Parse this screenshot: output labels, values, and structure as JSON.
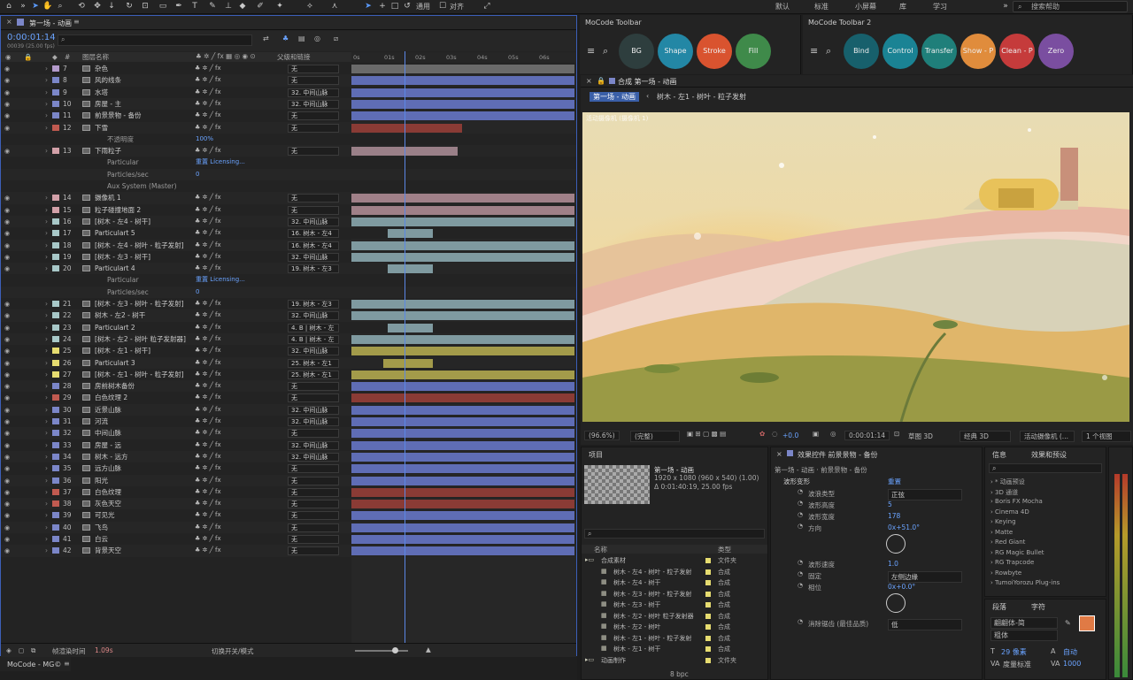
{
  "menu": {
    "workspaces": [
      "默认",
      "标准",
      "小屏幕",
      "库",
      "学习"
    ],
    "search_placeholder": "搜索帮助",
    "align_label": "对齐",
    "usage_label": "通用"
  },
  "timeline": {
    "tab_title": "第一场 - 动画",
    "timecode": "0:00:01:14",
    "fps_label": "00039 (25.00 fps)",
    "columns": {
      "name": "图层名称",
      "parent": "父级和链接",
      "hash": "#"
    },
    "ruler": [
      "0s",
      "01s",
      "02s",
      "03s",
      "04s",
      "05s",
      "06s"
    ],
    "footer_render": "帧渲染时间",
    "render_time": "1.09s",
    "switch_label": "切换开关/模式",
    "rows": [
      {
        "n": "7",
        "name": "杂色",
        "parent": "无",
        "label": "#b39acb",
        "bar": "#6a6a6a",
        "bs": 0,
        "be": 100
      },
      {
        "n": "8",
        "name": "风的线条",
        "parent": "无",
        "label": "#7b86c8",
        "bar": "#5f6db5",
        "bs": 0,
        "be": 100
      },
      {
        "n": "9",
        "name": "水塔",
        "parent": "32. 中间山脉",
        "label": "#7b86c8",
        "bar": "#5f6db5",
        "bs": 0,
        "be": 100
      },
      {
        "n": "10",
        "name": "房屋 - 主",
        "parent": "32. 中间山脉",
        "label": "#7b86c8",
        "bar": "#5f6db5",
        "bs": 0,
        "be": 100
      },
      {
        "n": "11",
        "name": "前景景物 - 备份",
        "parent": "无",
        "label": "#7b86c8",
        "bar": "#5f6db5",
        "bs": 0,
        "be": 100
      },
      {
        "n": "12",
        "name": "下雪",
        "parent": "无",
        "label": "#c05a50",
        "bar": "#8a3b35",
        "bs": 0,
        "be": 50
      },
      {
        "n": "",
        "name": "不透明度",
        "parent": "",
        "label": "",
        "bar": "",
        "bs": 0,
        "be": 0,
        "sub": true,
        "val": "100%"
      },
      {
        "n": "13",
        "name": "下雨粒子",
        "parent": "无",
        "label": "#d2a0a8",
        "bar": "#9a8088",
        "bs": 0,
        "be": 48
      },
      {
        "n": "",
        "name": "Particular",
        "parent": "",
        "label": "",
        "bar": "",
        "bs": 0,
        "be": 0,
        "sub": true,
        "val": "重置   Licensing..."
      },
      {
        "n": "",
        "name": "Particles/sec",
        "parent": "",
        "label": "",
        "bar": "",
        "bs": 0,
        "be": 0,
        "sub": true,
        "val": "0"
      },
      {
        "n": "",
        "name": "Aux System (Master)",
        "parent": "",
        "label": "",
        "bar": "",
        "bs": 0,
        "be": 0,
        "sub": true,
        "val": ""
      },
      {
        "n": "14",
        "name": "摄像机 1",
        "parent": "无",
        "label": "#d2a0a8",
        "bar": "#a08088",
        "bs": 0,
        "be": 100
      },
      {
        "n": "15",
        "name": "粒子碰撞地面 2",
        "parent": "无",
        "label": "#d2a0a8",
        "bar": "#a08088",
        "bs": 0,
        "be": 100
      },
      {
        "n": "16",
        "name": "[树木 - 左4 - 树干]",
        "parent": "32. 中间山脉",
        "label": "#a8c8c8",
        "bar": "#7f9aa0",
        "bs": 0,
        "be": 100
      },
      {
        "n": "17",
        "name": "Particulart 5",
        "parent": "16. 树木 - 左4",
        "label": "#a8c8c8",
        "bar": "#7f9aa0",
        "bs": 16,
        "be": 37
      },
      {
        "n": "18",
        "name": "[树木 - 左4 - 树叶 - 粒子发射]",
        "parent": "16. 树木 - 左4",
        "label": "#a8c8c8",
        "bar": "#7f9aa0",
        "bs": 0,
        "be": 100
      },
      {
        "n": "19",
        "name": "[树木 - 左3 - 树干]",
        "parent": "32. 中间山脉",
        "label": "#a8c8c8",
        "bar": "#7f9aa0",
        "bs": 0,
        "be": 100
      },
      {
        "n": "20",
        "name": "Particulart 4",
        "parent": "19. 树木 - 左3",
        "label": "#a8c8c8",
        "bar": "#7f9aa0",
        "bs": 16,
        "be": 37
      },
      {
        "n": "",
        "name": "Particular",
        "parent": "",
        "label": "",
        "bar": "",
        "bs": 0,
        "be": 0,
        "sub": true,
        "val": "重置   Licensing..."
      },
      {
        "n": "",
        "name": "Particles/sec",
        "parent": "",
        "label": "",
        "bar": "",
        "bs": 0,
        "be": 0,
        "sub": true,
        "val": "0"
      },
      {
        "n": "21",
        "name": "[树木 - 左3 - 树叶 - 粒子发射]",
        "parent": "19. 树木 - 左3",
        "label": "#a8c8c8",
        "bar": "#7f9aa0",
        "bs": 0,
        "be": 100
      },
      {
        "n": "22",
        "name": "树木 - 左2 - 树干",
        "parent": "32. 中间山脉",
        "label": "#a8c8c8",
        "bar": "#7f9aa0",
        "bs": 0,
        "be": 100
      },
      {
        "n": "23",
        "name": "Particulart 2",
        "parent": "4. B | 树木 - 左",
        "label": "#a8c8c8",
        "bar": "#7f9aa0",
        "bs": 16,
        "be": 37
      },
      {
        "n": "24",
        "name": "[树木 - 左2 - 树叶 粒子发射器]",
        "parent": "4. B | 树木 - 左",
        "label": "#a8c8c8",
        "bar": "#7f9aa0",
        "bs": 0,
        "be": 100
      },
      {
        "n": "25",
        "name": "[树木 - 左1 - 树干]",
        "parent": "32. 中间山脉",
        "label": "#e6dc70",
        "bar": "#a39b4a",
        "bs": 0,
        "be": 100
      },
      {
        "n": "26",
        "name": "Particulart 3",
        "parent": "25. 树木 - 左1",
        "label": "#e6dc70",
        "bar": "#a39b4a",
        "bs": 14,
        "be": 37
      },
      {
        "n": "27",
        "name": "[树木 - 左1 - 树叶 - 粒子发射]",
        "parent": "25. 树木 - 左1",
        "label": "#e6dc70",
        "bar": "#a39b4a",
        "bs": 0,
        "be": 100
      },
      {
        "n": "28",
        "name": "房前树木备份",
        "parent": "无",
        "label": "#7b86c8",
        "bar": "#5f6db5",
        "bs": 0,
        "be": 100
      },
      {
        "n": "29",
        "name": "白色纹理 2",
        "parent": "无",
        "label": "#c05a50",
        "bar": "#8a3b35",
        "bs": 0,
        "be": 100
      },
      {
        "n": "30",
        "name": "近景山脉",
        "parent": "32. 中间山脉",
        "label": "#7b86c8",
        "bar": "#5f6db5",
        "bs": 0,
        "be": 100
      },
      {
        "n": "31",
        "name": "河流",
        "parent": "32. 中间山脉",
        "label": "#7b86c8",
        "bar": "#5f6db5",
        "bs": 0,
        "be": 100
      },
      {
        "n": "32",
        "name": "中间山脉",
        "parent": "无",
        "label": "#7b86c8",
        "bar": "#5f6db5",
        "bs": 0,
        "be": 100
      },
      {
        "n": "33",
        "name": "房屋 - 远",
        "parent": "32. 中间山脉",
        "label": "#7b86c8",
        "bar": "#5f6db5",
        "bs": 0,
        "be": 100
      },
      {
        "n": "34",
        "name": "树木 - 远方",
        "parent": "32. 中间山脉",
        "label": "#7b86c8",
        "bar": "#5f6db5",
        "bs": 0,
        "be": 100
      },
      {
        "n": "35",
        "name": "远方山脉",
        "parent": "无",
        "label": "#7b86c8",
        "bar": "#5f6db5",
        "bs": 0,
        "be": 100
      },
      {
        "n": "36",
        "name": "阳光",
        "parent": "无",
        "label": "#7b86c8",
        "bar": "#5f6db5",
        "bs": 0,
        "be": 100
      },
      {
        "n": "37",
        "name": "白色纹理",
        "parent": "无",
        "label": "#c05a50",
        "bar": "#8a3b35",
        "bs": 0,
        "be": 100
      },
      {
        "n": "38",
        "name": "灰色天空",
        "parent": "无",
        "label": "#c05a50",
        "bar": "#8a3b35",
        "bs": 0,
        "be": 100
      },
      {
        "n": "39",
        "name": "可见光",
        "parent": "无",
        "label": "#7b86c8",
        "bar": "#5f6db5",
        "bs": 0,
        "be": 100
      },
      {
        "n": "40",
        "name": "飞鸟",
        "parent": "无",
        "label": "#7b86c8",
        "bar": "#5f6db5",
        "bs": 0,
        "be": 100
      },
      {
        "n": "41",
        "name": "白云",
        "parent": "无",
        "label": "#7b86c8",
        "bar": "#5f6db5",
        "bs": 0,
        "be": 100
      },
      {
        "n": "42",
        "name": "背景天空",
        "parent": "无",
        "label": "#7b86c8",
        "bar": "#5f6db5",
        "bs": 0,
        "be": 100
      }
    ]
  },
  "mocode1": {
    "title": "MoCode Toolbar",
    "buttons": [
      {
        "label": "BG",
        "color": "#2e3e3e"
      },
      {
        "label": "Shape",
        "color": "#2387a5"
      },
      {
        "label": "Stroke",
        "color": "#d9532f"
      },
      {
        "label": "Fill",
        "color": "#3f8a4a"
      }
    ]
  },
  "mocode2": {
    "title": "MoCode Toolbar 2",
    "buttons": [
      {
        "label": "Bind",
        "color": "#17606c"
      },
      {
        "label": "Control",
        "color": "#1a8394"
      },
      {
        "label": "Transfer",
        "color": "#1f7f7a"
      },
      {
        "label": "Show - P",
        "color": "#e08c3c"
      },
      {
        "label": "Clean - P",
        "color": "#c53b3b"
      },
      {
        "label": "Zero",
        "color": "#7a4ea0"
      }
    ]
  },
  "comp": {
    "tab": "合成 第一场 - 动画",
    "crumb1": "第一场 - 动画",
    "crumb2": "树木 - 左1 - 树叶 - 粒子发射",
    "camera": "活动摄像机 (摄像机 1)",
    "zoom": "(96.6%)",
    "quality": "(完整)",
    "time": "0:00:01:14",
    "exposure": "+0.0",
    "draft": "草图 3D",
    "renderer": "经典 3D",
    "cam": "活动摄像机 (...",
    "views": "1 个视图"
  },
  "project": {
    "tab": "项目",
    "name": "第一场 - 动画",
    "dims": "1920 x 1080 (960 x 540) (1.00)",
    "dur": "Δ 0:01:40:19, 25.00 fps",
    "col_name": "名称",
    "col_type": "类型",
    "bpc": "8 bpc",
    "items": [
      {
        "name": "合成素材",
        "type": "文件夹",
        "folder": true
      },
      {
        "name": "树木 - 左4 - 树叶 - 粒子发射",
        "type": "合成"
      },
      {
        "name": "树木 - 左4 - 树干",
        "type": "合成"
      },
      {
        "name": "树木 - 左3 - 树叶 - 粒子发射",
        "type": "合成"
      },
      {
        "name": "树木 - 左3 - 树干",
        "type": "合成"
      },
      {
        "name": "树木 - 左2 - 树叶 粒子发射器",
        "type": "合成"
      },
      {
        "name": "树木 - 左2 - 树叶",
        "type": "合成"
      },
      {
        "name": "树木 - 左1 - 树叶 - 粒子发射",
        "type": "合成"
      },
      {
        "name": "树木 - 左1 - 树干",
        "type": "合成"
      },
      {
        "name": "动画制作",
        "type": "文件夹",
        "folder": true
      }
    ]
  },
  "effects": {
    "tab": "效果控件 前景景物 - 备份",
    "crumb": "第一场 - 动画 · 前景景物 - 备份",
    "fx": "波形变形",
    "reset": "重置",
    "props": [
      {
        "k": "波浪类型",
        "v": "正弦",
        "dd": true
      },
      {
        "k": "波形高度",
        "v": "5"
      },
      {
        "k": "波形宽度",
        "v": "178"
      },
      {
        "k": "方向",
        "v": "0x+51.0°",
        "dial": true
      },
      {
        "k": "波形速度",
        "v": "1.0"
      },
      {
        "k": "固定",
        "v": "左侧边缘",
        "dd": true
      },
      {
        "k": "相位",
        "v": "0x+0.0°",
        "dial": true
      },
      {
        "k": "消除锯齿 (最佳品质)",
        "v": "低",
        "dd": true
      }
    ]
  },
  "fxpresets": {
    "tab_info": "信息",
    "tab": "效果和预设",
    "items": [
      "* 动画预设",
      "3D 通道",
      "Boris FX Mocha",
      "Cinema 4D",
      "Keying",
      "Matte",
      "Red Giant",
      "RG Magic Bullet",
      "RG Trapcode",
      "Rowbyte",
      "TumoiYorozu Plug-ins"
    ]
  },
  "character": {
    "tab1": "段落",
    "tab2": "字符",
    "font": "翩翩体-简",
    "style": "粗体",
    "size": "29 像素",
    "leading": "自动",
    "kerning": "度量标准",
    "tracking": "1000",
    "fill": "#e07a45"
  },
  "footer": {
    "mocode": "MoCode - MG©"
  }
}
